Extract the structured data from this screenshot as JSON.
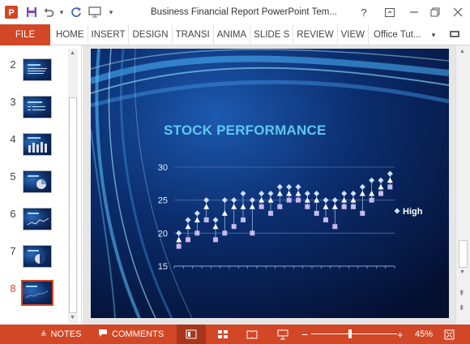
{
  "app": {
    "window_title": "Business Financial Report PowerPoint Tem...",
    "colors": {
      "accent": "#d24726",
      "slide_bg": "#071a45",
      "title_color": "#5ec8f0"
    }
  },
  "ribbon": {
    "file_label": "FILE",
    "tabs": [
      "HOME",
      "INSERT",
      "DESIGN",
      "TRANSI",
      "ANIMA",
      "SLIDE S",
      "REVIEW",
      "VIEW"
    ],
    "account": "Office Tut..."
  },
  "slides_panel": {
    "items": [
      {
        "num": "2",
        "current": false
      },
      {
        "num": "3",
        "current": false
      },
      {
        "num": "4",
        "current": false
      },
      {
        "num": "5",
        "current": false
      },
      {
        "num": "6",
        "current": false
      },
      {
        "num": "7",
        "current": false
      },
      {
        "num": "8",
        "current": true
      }
    ]
  },
  "slide": {
    "title": "STOCK PERFORMANCE",
    "legend": "High"
  },
  "chart_data": {
    "type": "scatter",
    "title": "STOCK PERFORMANCE",
    "ylim": [
      15,
      30
    ],
    "yticks": [
      "30",
      "25",
      "20",
      "15"
    ],
    "grid": true,
    "legend_position": "right",
    "series": [
      {
        "name": "High",
        "marker": "diamond",
        "values": [
          20,
          22,
          23,
          25,
          22,
          25,
          25,
          26,
          25,
          26,
          26,
          27,
          27,
          27,
          26,
          26,
          25,
          25,
          26,
          26,
          27,
          28,
          28,
          29
        ]
      },
      {
        "marker": "triangle",
        "values": [
          19,
          21,
          22,
          24,
          21,
          23,
          24,
          24,
          24,
          25,
          25,
          26,
          26,
          26,
          25,
          25,
          24,
          24,
          25,
          25,
          26,
          26,
          27,
          28
        ]
      },
      {
        "marker": "square",
        "values": [
          18,
          19,
          20,
          22,
          19,
          20,
          21,
          22,
          20,
          24,
          23,
          24,
          25,
          25,
          24,
          23,
          22,
          21,
          24,
          24,
          23,
          25,
          26,
          27
        ]
      }
    ]
  },
  "status": {
    "notes": "NOTES",
    "comments": "COMMENTS",
    "zoom": "45%",
    "zoom_level": 0.45
  }
}
